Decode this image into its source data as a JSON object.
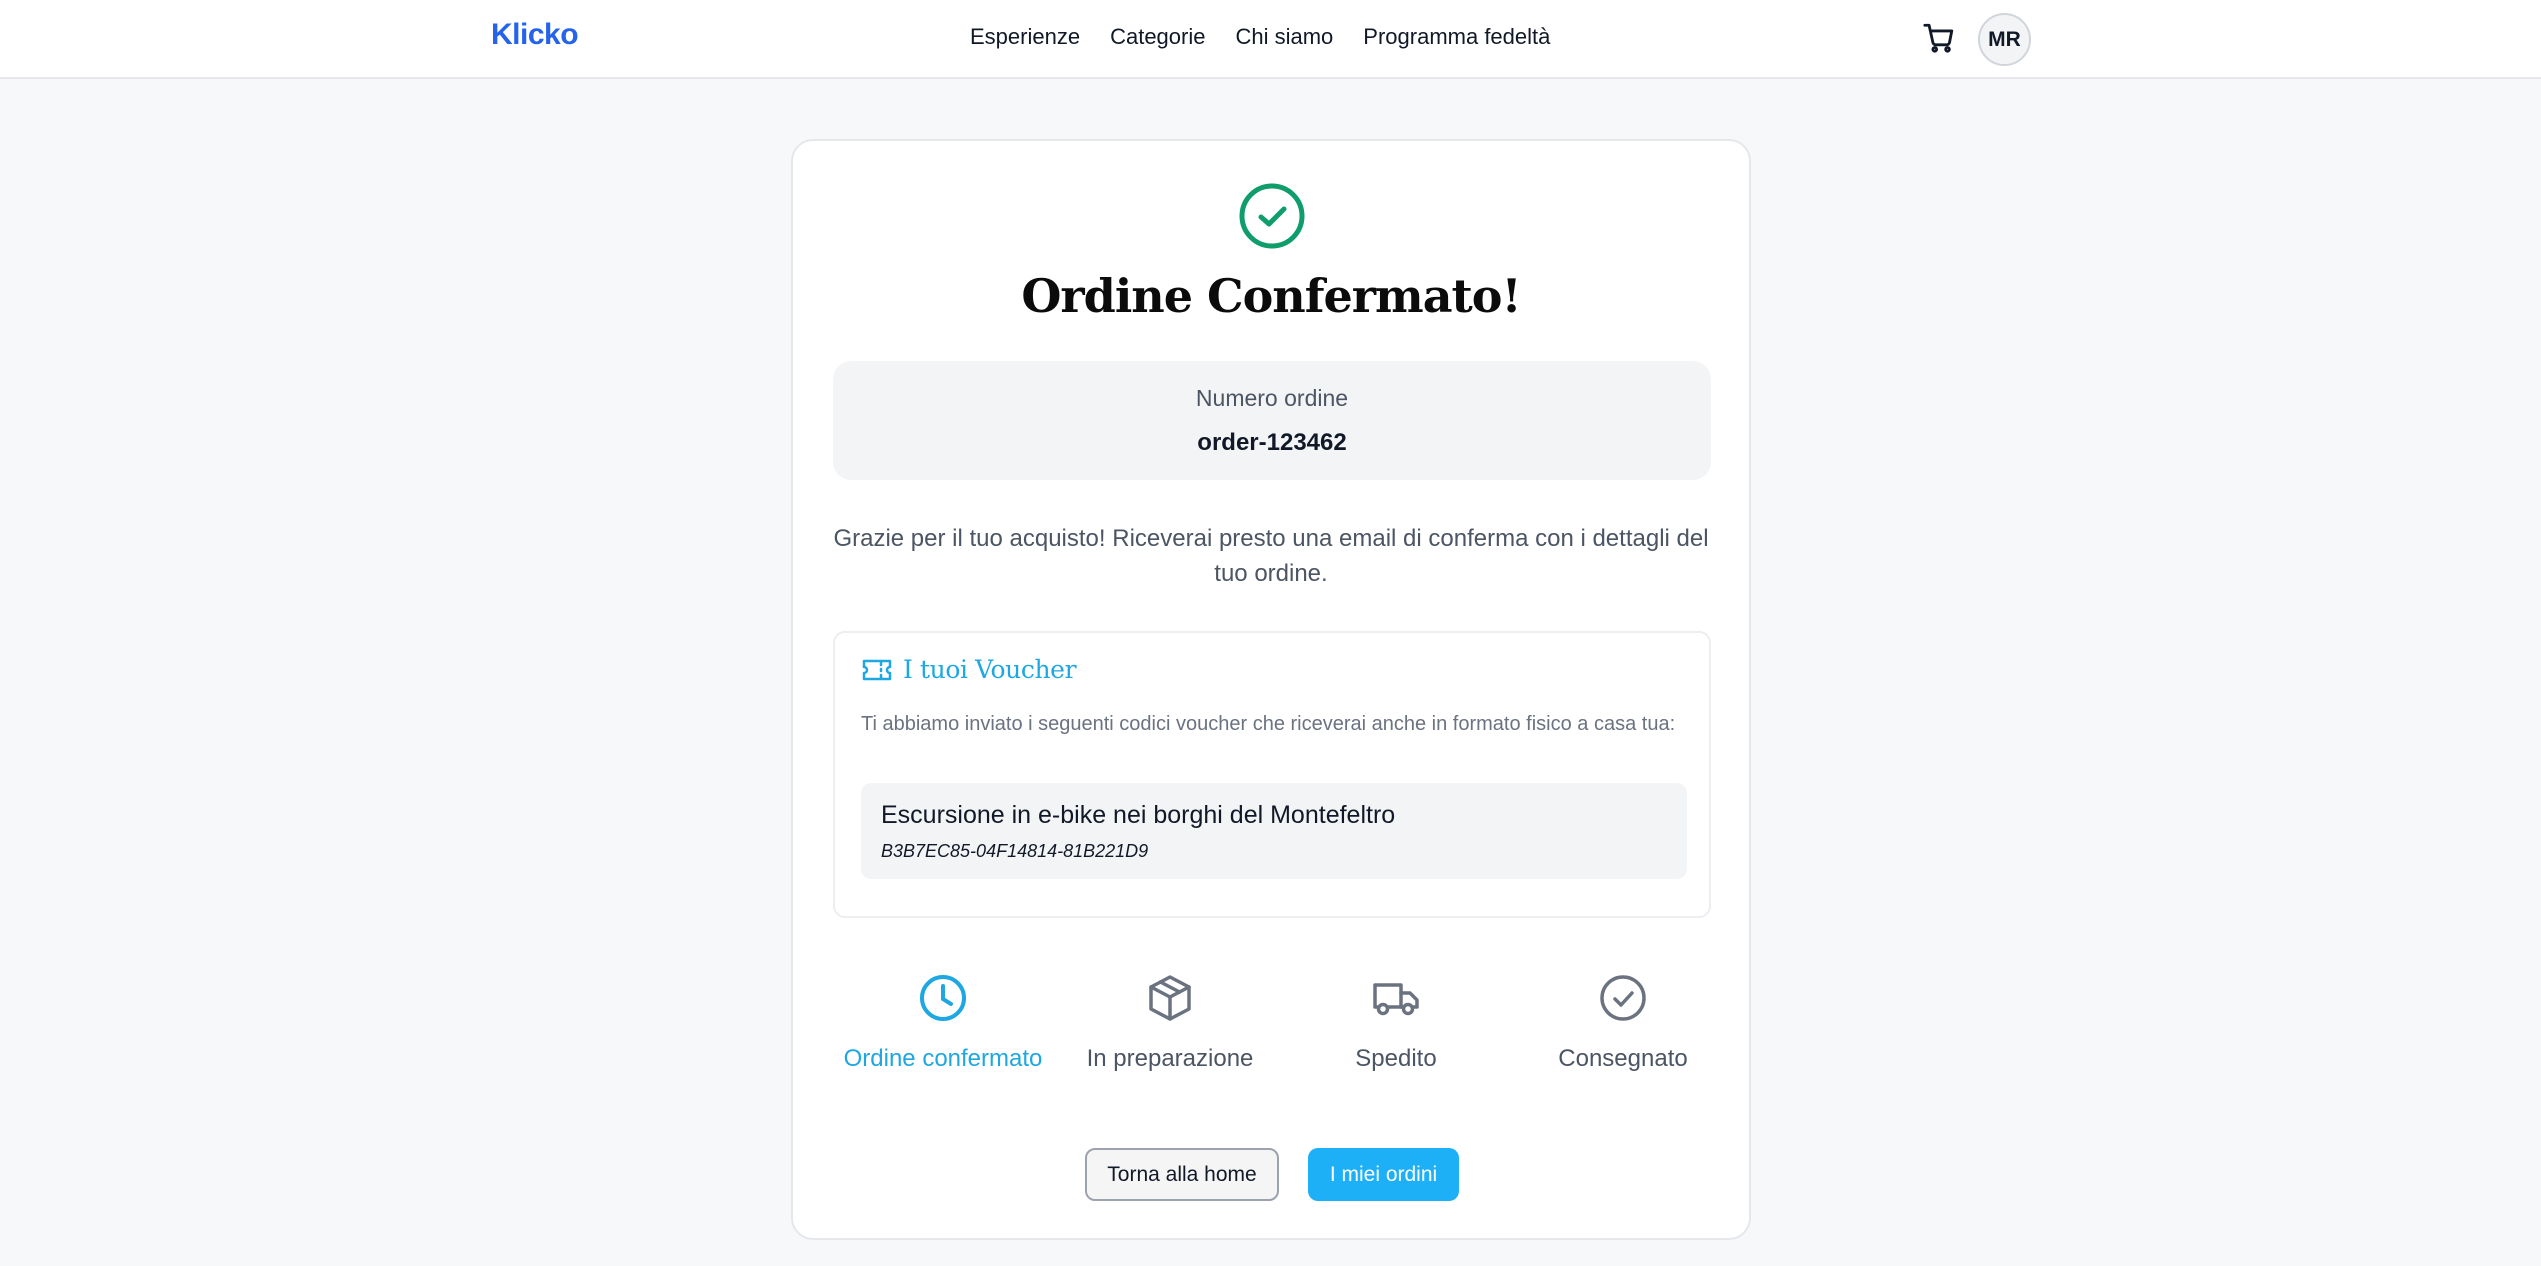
{
  "header": {
    "logo": "Klicko",
    "nav": [
      "Esperienze",
      "Categorie",
      "Chi siamo",
      "Programma fedeltà"
    ],
    "cart_icon": "shopping-cart-icon",
    "avatar_initials": "MR"
  },
  "confirmation": {
    "icon": "check-circle-icon",
    "title": "Ordine Confermato!",
    "order_label": "Numero ordine",
    "order_number": "order-123462",
    "thanks_message": "Grazie per il tuo acquisto! Riceverai presto una email di conferma con i dettagli del tuo ordine."
  },
  "vouchers": {
    "icon": "ticket-icon",
    "title": "I tuoi Voucher",
    "description": "Ti abbiamo inviato i seguenti codici voucher che riceverai anche in formato fisico a casa tua:",
    "items": [
      {
        "name": "Escursione in e-bike nei borghi del Montefeltro",
        "code": "B3B7EC85-04F14814-81B221D9"
      }
    ]
  },
  "steps": [
    {
      "label": "Ordine confermato",
      "icon": "clock-icon",
      "active": true
    },
    {
      "label": "In preparazione",
      "icon": "package-icon",
      "active": false
    },
    {
      "label": "Spedito",
      "icon": "truck-icon",
      "active": false
    },
    {
      "label": "Consegnato",
      "icon": "check-circle-icon",
      "active": false
    }
  ],
  "buttons": {
    "home": "Torna alla home",
    "orders": "I miei ordini"
  },
  "colors": {
    "brand": "#2563eb",
    "success": "#0f9d6b",
    "accent": "#1ea7e1",
    "primary_button": "#1eb0f7"
  }
}
